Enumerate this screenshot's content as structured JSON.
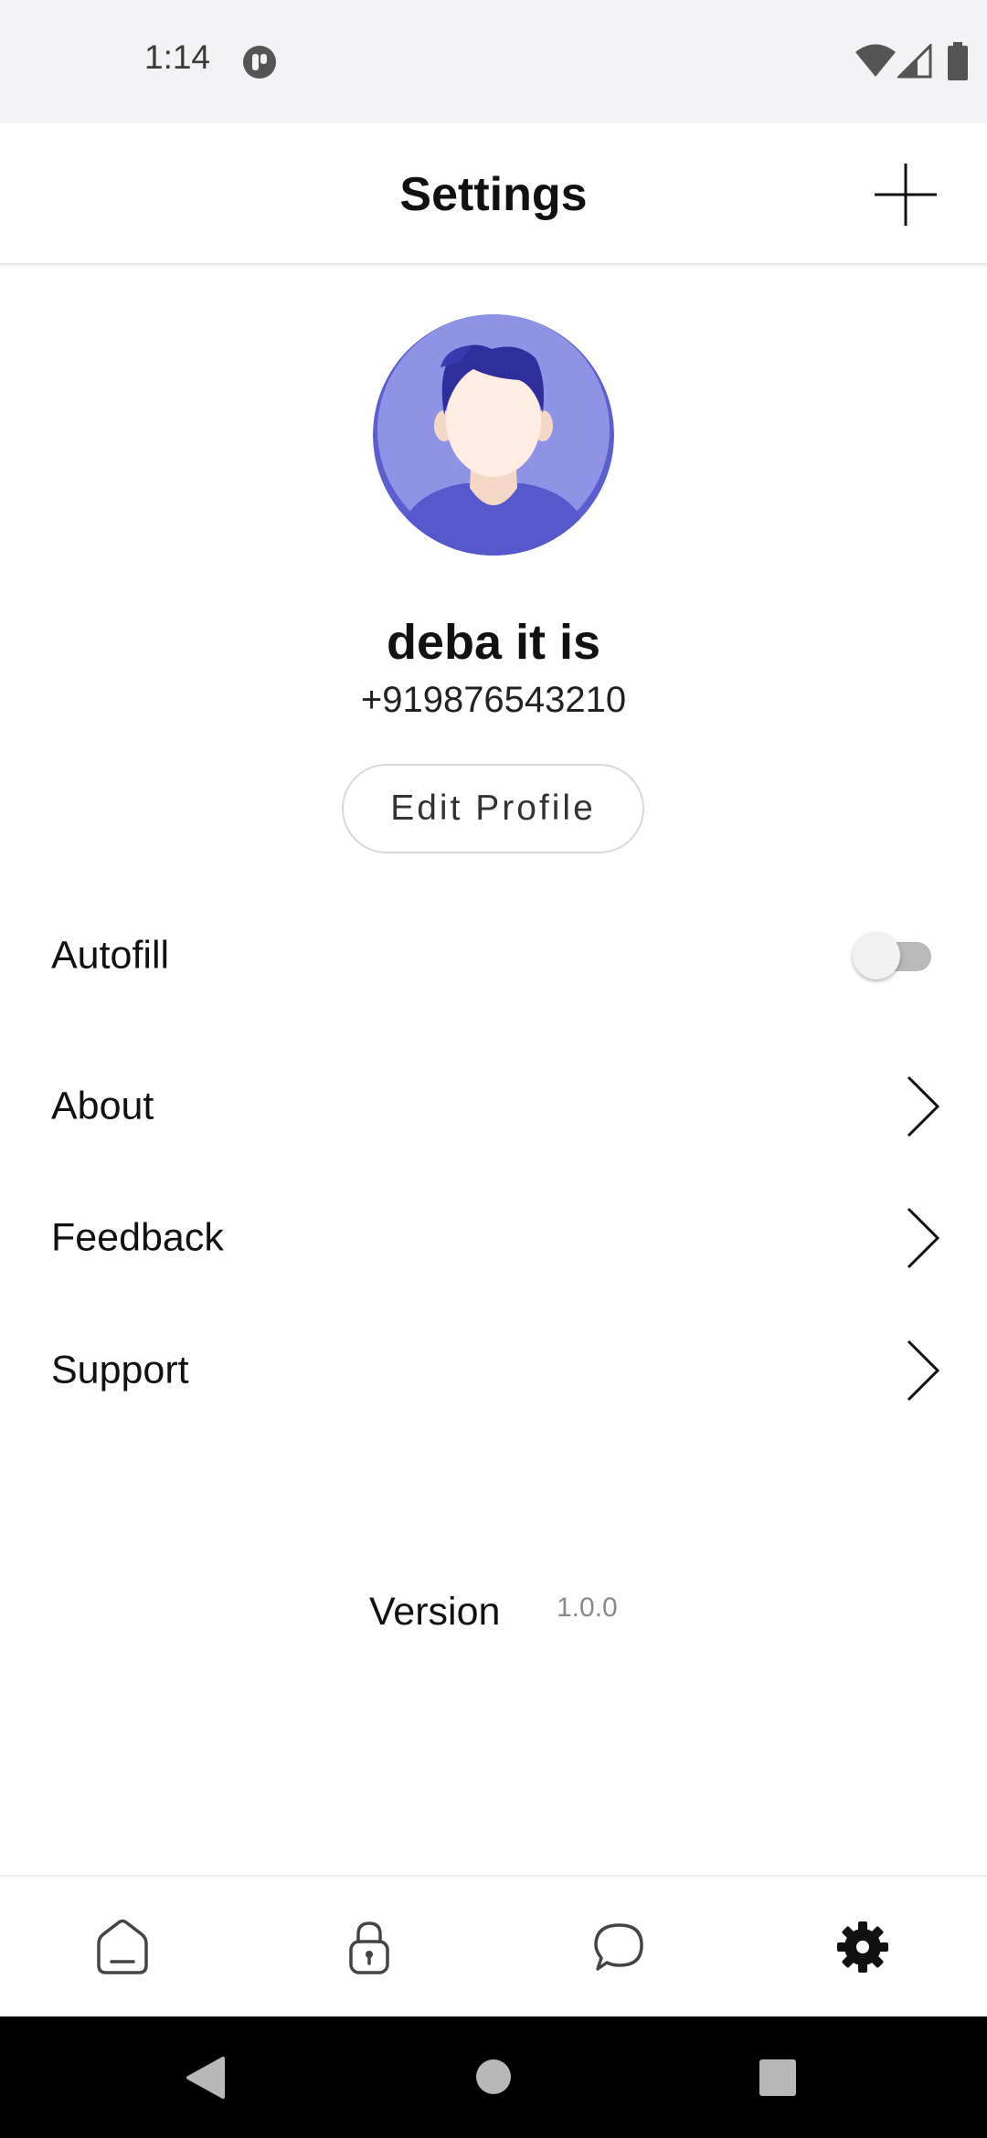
{
  "status_bar": {
    "time": "1:14",
    "icons": [
      "app-notification-icon",
      "wifi-icon",
      "cell-signal-icon",
      "battery-icon"
    ]
  },
  "app_bar": {
    "title": "Settings",
    "action_icon": "plus-icon"
  },
  "profile": {
    "avatar_icon": "user-avatar",
    "name": "deba it is",
    "phone": "+919876543210",
    "edit_label": "Edit Profile"
  },
  "settings": {
    "autofill": {
      "label": "Autofill",
      "enabled": false
    },
    "items": [
      {
        "label": "About",
        "icon": "chevron-right-icon"
      },
      {
        "label": "Feedback",
        "icon": "chevron-right-icon"
      },
      {
        "label": "Support",
        "icon": "chevron-right-icon"
      }
    ]
  },
  "version": {
    "label": "Version",
    "value": "1.0.0"
  },
  "bottom_nav": {
    "items": [
      {
        "icon": "home-icon",
        "active": false
      },
      {
        "icon": "lock-icon",
        "active": false
      },
      {
        "icon": "chat-icon",
        "active": false
      },
      {
        "icon": "settings-gear-icon",
        "active": true
      }
    ]
  },
  "colors": {
    "avatar_bg": "#8f93e6",
    "avatar_hair": "#2f2f9c",
    "avatar_shirt": "#5559cc",
    "skin": "#ffede3",
    "active_nav": "#111111",
    "inactive_nav": "#444444"
  }
}
